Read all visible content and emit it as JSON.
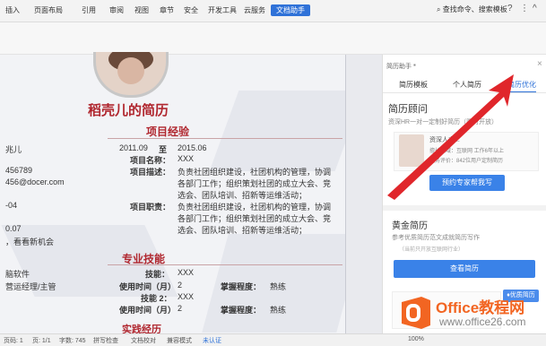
{
  "ribbon": {
    "tabs": [
      "插入",
      "页面布局",
      "引用",
      "审阅",
      "视图",
      "章节",
      "安全",
      "开发工具",
      "云服务"
    ],
    "active_tab": "文档助手",
    "search": "查找命令、搜索模板",
    "help": "?",
    "more": "⋮",
    "collapse": "^"
  },
  "document": {
    "title": "稻壳儿的简历",
    "left_col": [
      "兆儿",
      "456789",
      "456@docer.com",
      "-04",
      "0.07",
      "，看看新机会"
    ],
    "left_col2": [
      "脑软件",
      "营运经理/主管"
    ],
    "experience": {
      "section": "项目经验",
      "start": "2011.09",
      "to": "至",
      "end": "2015.06",
      "name_label": "项目名称：",
      "name_value": "XXX",
      "desc_label": "项目描述：",
      "desc_lines": [
        "负责社团组织建设，社团机构的管理，协调",
        "各部门工作；组织策划社团的成立大会、竞",
        "选会、团队培训、招新等运维活动；"
      ],
      "duty_label": "项目职责：",
      "duty_lines": [
        "负责社团组织建设，社团机构的管理，协调",
        "各部门工作；组织策划社团的成立大会、竞",
        "选会、团队培训、招新等运维活动；"
      ]
    },
    "skills": {
      "section": "专业技能",
      "skill_label": "技能：",
      "skill_value": "XXX",
      "time_label": "使用时间（月）",
      "time_value": "2",
      "level_label": "掌握程度：",
      "level_value": "熟练",
      "skill2_label": "技能 2：",
      "skill2_value": "XXX",
      "time2_value": "2",
      "level2_value": "熟练"
    },
    "next_section": "实践经历"
  },
  "panel": {
    "title": "简历助手",
    "close": "×",
    "tabs": [
      "简历模板",
      "个人简历",
      "简历优化"
    ],
    "active_tab": "简历优化",
    "advisor": {
      "heading": "简历顾问",
      "subtitle": "资深HR一对一定制好简历（限时开放）",
      "name": "资深人力...",
      "line1": "擅长领域：互联网  工作6年以上",
      "line2": "服务评价：842位用户定制简历",
      "button": "预约专家帮我写"
    },
    "gold": {
      "heading": "黄金简历",
      "subtitle": "参考优质简历范文成就简历写作",
      "note": "（当前只开放互联网行业）",
      "button": "查看简历",
      "badge": "优质简历"
    }
  },
  "status": {
    "page": "页码: 1",
    "pages": "页: 1/1",
    "words": "字数: 745",
    "spell": "拼写检查",
    "compare": "文档校对",
    "protect": "兼容模式",
    "cert": "未认证",
    "zoom": "100%"
  },
  "watermark": {
    "brand": "Office教程网",
    "url": "www.office26.com"
  },
  "colors": {
    "accent": "#2f72d8",
    "resume_red": "#b0262e",
    "arrow_red": "#e0262b",
    "logo_orange": "#f26522"
  }
}
